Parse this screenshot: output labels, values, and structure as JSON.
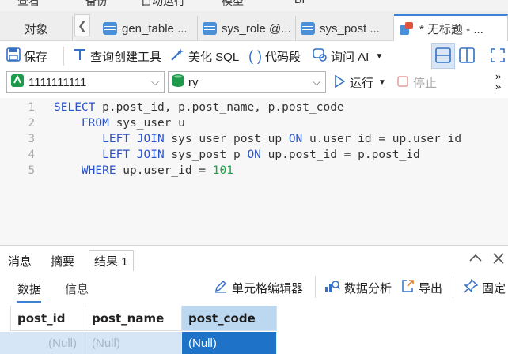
{
  "top_menu": [
    "查看",
    "备份",
    "自动运行",
    "模型",
    "BI"
  ],
  "tabs": {
    "objects_label": "对象",
    "items": [
      {
        "label": "gen_table ..."
      },
      {
        "label": "sys_role @..."
      },
      {
        "label": "sys_post ..."
      },
      {
        "label": "* 无标题 - ..."
      }
    ]
  },
  "toolbar": {
    "save": "保存",
    "query_builder": "查询创建工具",
    "beautify": "美化 SQL",
    "code_snippet": "代码段",
    "ask_ai": "询问 AI"
  },
  "connection": {
    "connection_name": "1111111111",
    "database": "ry",
    "run": "运行",
    "stop": "停止"
  },
  "editor": {
    "line_numbers": [
      "1",
      "2",
      "3",
      "4",
      "5"
    ],
    "lines": [
      {
        "parts": [
          {
            "t": "kw",
            "v": "SELECT"
          },
          {
            "t": "txt",
            "v": " p.post_id, p.post_name, p.post_code"
          }
        ]
      },
      {
        "parts": [
          {
            "t": "txt",
            "v": "    "
          },
          {
            "t": "kw",
            "v": "FROM"
          },
          {
            "t": "txt",
            "v": " sys_user u"
          }
        ]
      },
      {
        "parts": [
          {
            "t": "txt",
            "v": "       "
          },
          {
            "t": "kw",
            "v": "LEFT JOIN"
          },
          {
            "t": "txt",
            "v": " sys_user_post up "
          },
          {
            "t": "kw",
            "v": "ON"
          },
          {
            "t": "txt",
            "v": " u.user_id = up.user_id"
          }
        ]
      },
      {
        "parts": [
          {
            "t": "txt",
            "v": "       "
          },
          {
            "t": "kw",
            "v": "LEFT JOIN"
          },
          {
            "t": "txt",
            "v": " sys_post p "
          },
          {
            "t": "kw",
            "v": "ON"
          },
          {
            "t": "txt",
            "v": " up.post_id = p.post_id"
          }
        ]
      },
      {
        "parts": [
          {
            "t": "txt",
            "v": "    "
          },
          {
            "t": "kw",
            "v": "WHERE"
          },
          {
            "t": "txt",
            "v": " up.user_id = "
          },
          {
            "t": "num",
            "v": "101"
          }
        ]
      }
    ]
  },
  "bottom_tabs": {
    "messages": "消息",
    "summary": "摘要",
    "result": "结果 1"
  },
  "result_toolbar": {
    "data_tab": "数据",
    "info_tab": "信息",
    "cell_editor": "单元格编辑器",
    "data_analysis": "数据分析",
    "export": "导出",
    "pin": "固定"
  },
  "grid": {
    "columns": [
      "post_id",
      "post_name",
      "post_code"
    ],
    "rows": [
      [
        "(Null)",
        "(Null)",
        "(Null)"
      ]
    ],
    "selected_column": "post_code"
  },
  "colors": {
    "keyword": "#2b53c9",
    "number": "#1b9e44",
    "accent": "#3b82d6",
    "selected_cell": "#1e73c9"
  }
}
